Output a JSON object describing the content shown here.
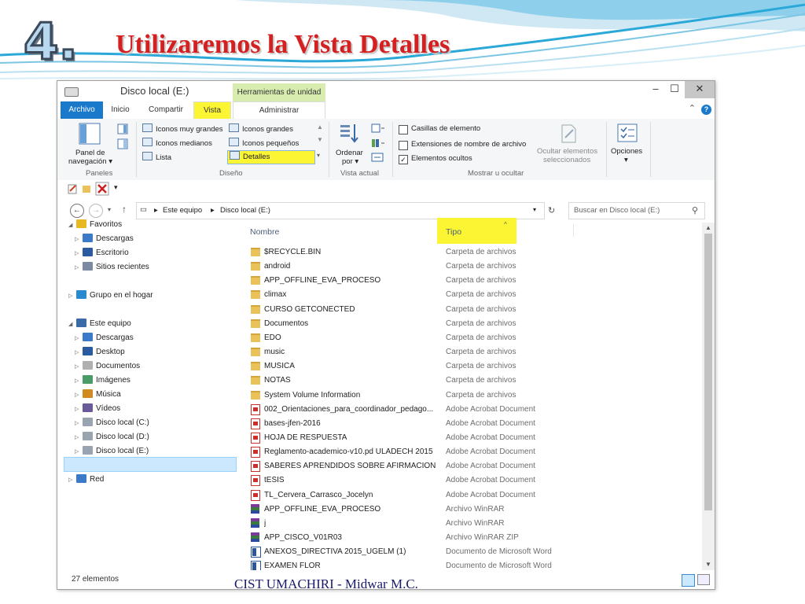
{
  "slide": {
    "number": "4.",
    "title": "Utilizaremos  la Vista Detalles",
    "footer": "CIST UMACHIRI - Midwar M.C."
  },
  "window": {
    "title": "Disco local (E:)",
    "contextual_tab_header": "Herramientas de unidad",
    "controls": {
      "minimize": "–",
      "maximize": "☐",
      "close": "✕"
    }
  },
  "tabs": [
    "Archivo",
    "Inicio",
    "Compartir",
    "Vista",
    "Administrar"
  ],
  "ribbon": {
    "panes_group": {
      "label": "Paneles",
      "nav_pane_line1": "Panel de",
      "nav_pane_line2": "navegación ▾"
    },
    "layout_group": {
      "label": "Diseño",
      "items": [
        "Iconos muy grandes",
        "Iconos grandes",
        "Iconos medianos",
        "Iconos pequeños",
        "Lista",
        "Detalles"
      ]
    },
    "current_view_group": {
      "label": "Vista actual",
      "sort_line1": "Ordenar",
      "sort_line2": "por ▾"
    },
    "show_hide_group": {
      "label": "Mostrar u ocultar",
      "checkboxes": [
        {
          "label": "Casillas de elemento",
          "checked": false
        },
        {
          "label": "Extensiones de nombre de archivo",
          "checked": false
        },
        {
          "label": "Elementos ocultos",
          "checked": true
        }
      ],
      "hide_selected_line1": "Ocultar elementos",
      "hide_selected_line2": "seleccionados"
    },
    "options": {
      "line1": "Opciones",
      "line2": "▾"
    }
  },
  "address": {
    "path": [
      "Este equipo",
      "Disco local (E:)"
    ],
    "search_placeholder": "Buscar en Disco local (E:)"
  },
  "nav": {
    "items": [
      {
        "label": "Favoritos",
        "icon": "star-icon",
        "level": 0,
        "expanded": true
      },
      {
        "label": "Descargas",
        "icon": "downloads-icon",
        "level": 1
      },
      {
        "label": "Escritorio",
        "icon": "desktop-icon",
        "level": 1
      },
      {
        "label": "Sitios recientes",
        "icon": "recent-icon",
        "level": 1
      },
      {
        "label": "Grupo en el hogar",
        "icon": "homegroup-icon",
        "level": 0,
        "expanded": false
      },
      {
        "label": "Este equipo",
        "icon": "computer-icon",
        "level": 0,
        "expanded": true
      },
      {
        "label": "Descargas",
        "icon": "downloads-icon",
        "level": 1
      },
      {
        "label": "Desktop",
        "icon": "desktop-icon",
        "level": 1
      },
      {
        "label": "Documentos",
        "icon": "documents-icon",
        "level": 1
      },
      {
        "label": "Imágenes",
        "icon": "pictures-icon",
        "level": 1
      },
      {
        "label": "Música",
        "icon": "music-icon",
        "level": 1
      },
      {
        "label": "Vídeos",
        "icon": "videos-icon",
        "level": 1
      },
      {
        "label": "Disco local (C:)",
        "icon": "drive-icon",
        "level": 1
      },
      {
        "label": "Disco local (D:)",
        "icon": "drive-icon",
        "level": 1
      },
      {
        "label": "Disco local (E:)",
        "icon": "drive-icon",
        "level": 1,
        "selected": true
      },
      {
        "label": "Red",
        "icon": "network-icon",
        "level": 0,
        "expanded": false
      }
    ]
  },
  "files": {
    "columns": {
      "name": "Nombre",
      "type": "Tipo"
    },
    "rows": [
      {
        "name": "$RECYCLE.BIN",
        "type": "Carpeta de archivos",
        "kind": "folder"
      },
      {
        "name": "android",
        "type": "Carpeta de archivos",
        "kind": "folder"
      },
      {
        "name": "APP_OFFLINE_EVA_PROCESO",
        "type": "Carpeta de archivos",
        "kind": "folder"
      },
      {
        "name": "climax",
        "type": "Carpeta de archivos",
        "kind": "folder"
      },
      {
        "name": "CURSO GETCONECTED",
        "type": "Carpeta de archivos",
        "kind": "folder"
      },
      {
        "name": "Documentos",
        "type": "Carpeta de archivos",
        "kind": "folder"
      },
      {
        "name": "EDO",
        "type": "Carpeta de archivos",
        "kind": "folder"
      },
      {
        "name": "music",
        "type": "Carpeta de archivos",
        "kind": "folder"
      },
      {
        "name": "MUSICA",
        "type": "Carpeta de archivos",
        "kind": "folder"
      },
      {
        "name": "NOTAS",
        "type": "Carpeta de archivos",
        "kind": "folder"
      },
      {
        "name": "System Volume Information",
        "type": "Carpeta de archivos",
        "kind": "folder"
      },
      {
        "name": "002_Orientaciones_para_coordinador_pedago...",
        "type": "Adobe Acrobat Document",
        "kind": "pdf"
      },
      {
        "name": "bases-jfen-2016",
        "type": "Adobe Acrobat Document",
        "kind": "pdf"
      },
      {
        "name": "HOJA DE RESPUESTA",
        "type": "Adobe Acrobat Document",
        "kind": "pdf"
      },
      {
        "name": "Reglamento-academico-v10.pd ULADECH 2015",
        "type": "Adobe Acrobat Document",
        "kind": "pdf"
      },
      {
        "name": "SABERES APRENDIDOS SOBRE AFIRMACION ...",
        "type": "Adobe Acrobat Document",
        "kind": "pdf"
      },
      {
        "name": "tESIS",
        "type": "Adobe Acrobat Document",
        "kind": "pdf"
      },
      {
        "name": "TL_Cervera_Carrasco_Jocelyn",
        "type": "Adobe Acrobat Document",
        "kind": "pdf"
      },
      {
        "name": "APP_OFFLINE_EVA_PROCESO",
        "type": "Archivo WinRAR",
        "kind": "rar"
      },
      {
        "name": "j",
        "type": "Archivo WinRAR",
        "kind": "rar"
      },
      {
        "name": "APP_CISCO_V01R03",
        "type": "Archivo WinRAR ZIP",
        "kind": "rar"
      },
      {
        "name": "ANEXOS_DIRECTIVA 2015_UGELM (1)",
        "type": "Documento de Microsoft Word",
        "kind": "word"
      },
      {
        "name": "EXAMEN FLOR",
        "type": "Documento de Microsoft Word",
        "kind": "word"
      }
    ]
  },
  "status": {
    "count": "27 elementos"
  },
  "colors": {
    "title_red": "#d42020",
    "accent_blue": "#1979ca",
    "highlight_yellow": "#fbf533",
    "tools_green": "#d8ecb0"
  }
}
